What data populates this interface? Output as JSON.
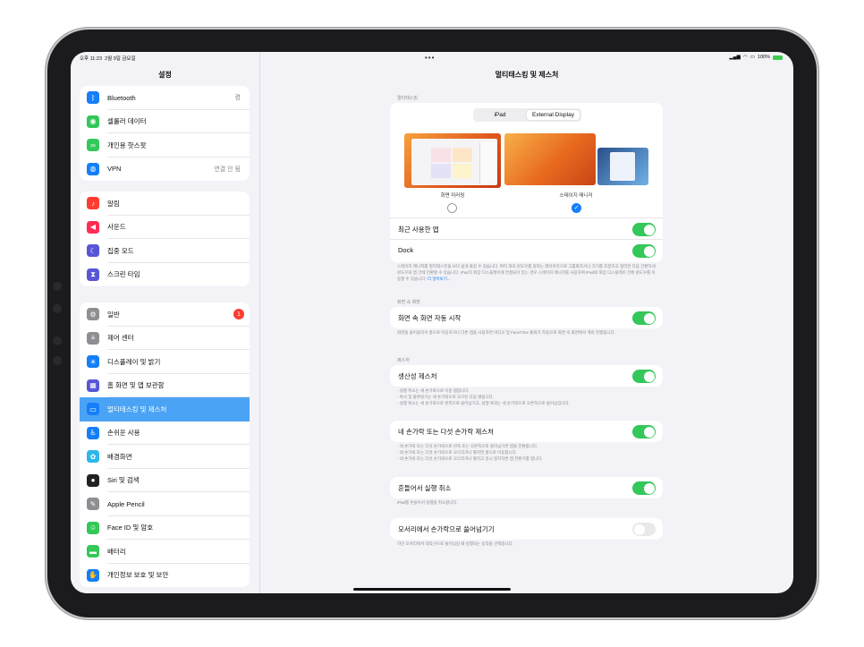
{
  "status": {
    "time": "오후 11:23",
    "date": "2월 9일 금요일",
    "battery": "100%"
  },
  "sidebar": {
    "title": "설정",
    "groups": [
      [
        {
          "label": "Bluetooth",
          "value": "켬",
          "icon": "bluetooth-icon",
          "color": "#147efb"
        },
        {
          "label": "셀룰러 데이터",
          "value": "",
          "icon": "antenna-icon",
          "color": "#34c759"
        },
        {
          "label": "개인용 핫스팟",
          "value": "",
          "icon": "link-icon",
          "color": "#34c759"
        },
        {
          "label": "VPN",
          "value": "연결 안 됨",
          "icon": "globe-icon",
          "color": "#147efb"
        }
      ],
      [
        {
          "label": "알림",
          "icon": "bell-icon",
          "color": "#ff3b30"
        },
        {
          "label": "사운드",
          "icon": "speaker-icon",
          "color": "#ff2d55"
        },
        {
          "label": "집중 모드",
          "icon": "moon-icon",
          "color": "#5856d6"
        },
        {
          "label": "스크린 타임",
          "icon": "hourglass-icon",
          "color": "#5856d6"
        }
      ],
      [
        {
          "label": "일반",
          "icon": "gear-icon",
          "color": "#8e8e93",
          "badge": "1"
        },
        {
          "label": "제어 센터",
          "icon": "switches-icon",
          "color": "#8e8e93"
        },
        {
          "label": "디스플레이 및 밝기",
          "icon": "sun-icon",
          "color": "#147efb"
        },
        {
          "label": "홈 화면 및 앱 보관함",
          "icon": "grid-icon",
          "color": "#5856d6"
        },
        {
          "label": "멀티태스킹 및 제스처",
          "icon": "multitask-icon",
          "color": "#147efb",
          "selected": true
        },
        {
          "label": "손쉬운 사용",
          "icon": "accessibility-icon",
          "color": "#147efb"
        },
        {
          "label": "배경화면",
          "icon": "flower-icon",
          "color": "#2fb7ec"
        },
        {
          "label": "Siri 및 검색",
          "icon": "siri-icon",
          "color": "#222222"
        },
        {
          "label": "Apple Pencil",
          "icon": "pencil-icon",
          "color": "#8e8e93"
        },
        {
          "label": "Face ID 및 암호",
          "icon": "face-id-icon",
          "color": "#34c759"
        },
        {
          "label": "배터리",
          "icon": "battery-icon",
          "color": "#34c759"
        },
        {
          "label": "개인정보 보호 및 보안",
          "icon": "hand-icon",
          "color": "#147efb"
        }
      ]
    ]
  },
  "main": {
    "title": "멀티태스킹 및 제스처",
    "multitask": {
      "section": "멀티태스킹",
      "seg_ipad": "iPad",
      "seg_external": "External Display",
      "opt_mirror": "화면 미러링",
      "opt_stage": "스테이지 매니저",
      "recent_apps": "최근 사용한 앱",
      "dock": "Dock",
      "footer": "스테이지 매니저를 멀티태스킹을 보다 쉽게 즐길 수 있습니다. 여러 개의 윈도우를 원하는 레이아웃으로 그룹화하거나 크기를 조정하고 정리한 다음 간편하게 윈도우와 앱 간에 전환할 수 있습니다. iPad가 외장 디스플레이에 연결되어 있는 경우 스테이지 매니저를 사용하여 iPad와 외장 디스플레이 간에 윈도우를 이동할 수 있습니다.",
      "footer_link": "더 알아보기..."
    },
    "pip": {
      "section": "화면 속 화면",
      "label": "화면 속 화면 자동 시작",
      "footer": "화면을 쓸어올리서 홈으로 이동하거나 다른 앱을 사용하면 비디오 및 FaceTime 통화가 자동으로 화면 속 화면에서 계속 진행됩니다."
    },
    "gestures": {
      "section": "제스처",
      "productive": "생산성 제스처",
      "productive_footer": [
        "- 실행 취소는 세 손가락으로 이중 탭합니다.",
        "- 복사 및 붙여넣기는 세 손가락으로 오므린 다음 벌립니다.",
        "- 실행 취소는 세 손가락으로 왼쪽으로 쓸어넘기고, 실행 복귀는 세 손가락으로 오른쪽으로 쓸어넘깁니다."
      ],
      "four_five": "네 손가락 또는 다섯 손가락 제스처",
      "four_five_footer": [
        "- 네 손가락 또는 다섯 손가락으로 왼쪽 또는 오른쪽으로 쓸어넘기면 앱을 전환합니다.",
        "- 네 손가락 또는 다섯 손가락으로 오므리거나 펼치면 홈으로 이동합니다.",
        "- 네 손가락 또는 다섯 손가락으로 오므리거나 펼치고 일시 정지하면 앱 전환기를 엽니다."
      ],
      "shake": "흔들어서 실행 취소",
      "shake_footer": "iPad를 흔들어서 실행을 취소합니다.",
      "corner": "모서리에서 손가락으로 쓸어넘기기",
      "corner_footer": "하단 모서리에서 대각선으로 쓸어넘길 때 실행되는 동작을 선택합니다."
    }
  },
  "colors": {
    "accent": "#147efb",
    "toggle_on": "#34c759",
    "selected_row": "#4aa3f4"
  }
}
